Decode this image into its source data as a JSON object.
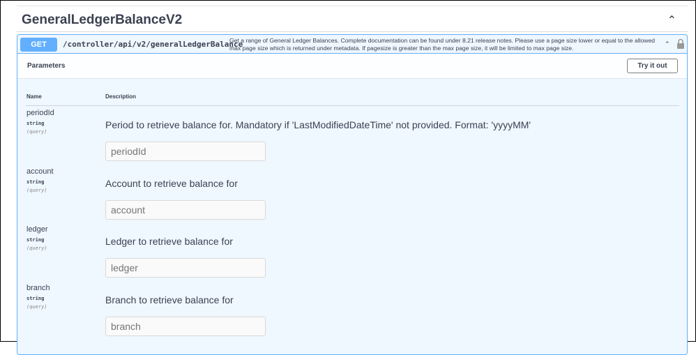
{
  "section": {
    "title": "GeneralLedgerBalanceV2"
  },
  "operation": {
    "method": "GET",
    "path": "/controller/api/v2/generalLedgerBalance",
    "description": "Get a range of General Ledger Balances. Complete documentation can be found under 8.21 release notes. Please use a page size lower or equal to the allowed max page size which is returned under metadata. If pagesize is greater than the max page size, it will be limited to max page size.",
    "colors": {
      "accent": "#61affe",
      "background": "#eff7ff"
    }
  },
  "parameters": {
    "title": "Parameters",
    "try_label": "Try it out",
    "col_name": "Name",
    "col_description": "Description",
    "items": [
      {
        "name": "periodId",
        "type": "string",
        "in": "(query)",
        "description": "Period to retrieve balance for. Mandatory if 'LastModifiedDateTime' not provided. Format: 'yyyyMM'",
        "placeholder": "periodId"
      },
      {
        "name": "account",
        "type": "string",
        "in": "(query)",
        "description": "Account to retrieve balance for",
        "placeholder": "account"
      },
      {
        "name": "ledger",
        "type": "string",
        "in": "(query)",
        "description": "Ledger to retrieve balance for",
        "placeholder": "ledger"
      },
      {
        "name": "branch",
        "type": "string",
        "in": "(query)",
        "description": "Branch to retrieve balance for",
        "placeholder": "branch"
      }
    ]
  }
}
